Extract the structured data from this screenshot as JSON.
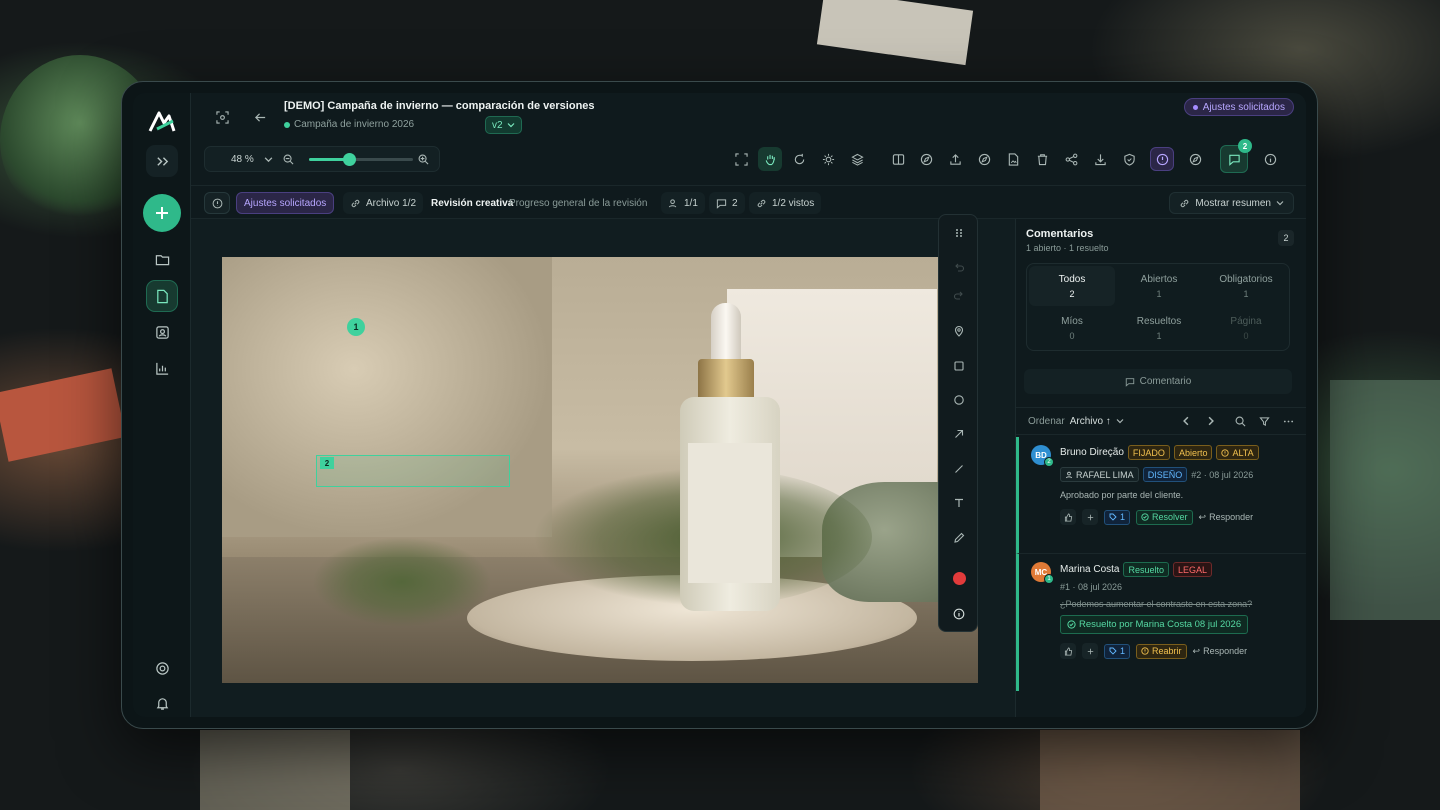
{
  "header": {
    "title": "[DEMO] Campaña de invierno — comparación de versiones",
    "project": "Campaña de invierno 2026",
    "version": "v2",
    "status": "Ajustes solicitados"
  },
  "toolbar": {
    "zoom": "48 %",
    "zoom_level": 0.38,
    "notification_count": "2"
  },
  "filter_bar": {
    "status": "Ajustes solicitados",
    "file": "Archivo 1/2",
    "review_title": "Revisión creativa",
    "review_subtitle": "Progreso general de la revisión",
    "assignees": "1/1",
    "comments": "2",
    "seen": "1/2 vistos",
    "summary": "Mostrar resumen"
  },
  "markers": {
    "m1": "1",
    "m2": "2"
  },
  "panel": {
    "title": "Comentarios",
    "subtitle": "1 abierto · 1 resuelto",
    "count": "2",
    "tabs": [
      {
        "label": "Todos",
        "count": "2"
      },
      {
        "label": "Abiertos",
        "count": "1"
      },
      {
        "label": "Obligatorios",
        "count": "1"
      },
      {
        "label": "Míos",
        "count": "0"
      },
      {
        "label": "Resueltos",
        "count": "1"
      },
      {
        "label": "Página",
        "count": "0"
      }
    ],
    "comment_button": "Comentario",
    "sort_label": "Ordenar",
    "sort_value": "Archivo ↑"
  },
  "comments": [
    {
      "initials": "BD",
      "author": "Bruno Direção",
      "tags": [
        "FIJADO",
        "Abierto",
        "ALTA"
      ],
      "assignee": "RAFAEL LIMA",
      "category": "DISEÑO",
      "meta": "#2 · 08 jul 2026",
      "text": "Aprobado por parte del cliente.",
      "votes": "1",
      "action": "Resolver",
      "reply": "Responder"
    },
    {
      "initials": "MC",
      "author": "Marina Costa",
      "tags": [
        "Resuelto",
        "LEGAL"
      ],
      "meta": "#1 · 08 jul 2026",
      "text": "¿Podemos aumentar el contraste en esta zona?",
      "resolved_note": "Resuelto por Marina Costa 08 jul 2026",
      "votes": "1",
      "action": "Reabrir",
      "reply": "Responder"
    }
  ],
  "colors": {
    "accent": "#3fd19d",
    "status": "#b7a6ff",
    "warning": "#f2c14f",
    "danger": "#ff6a6a"
  }
}
